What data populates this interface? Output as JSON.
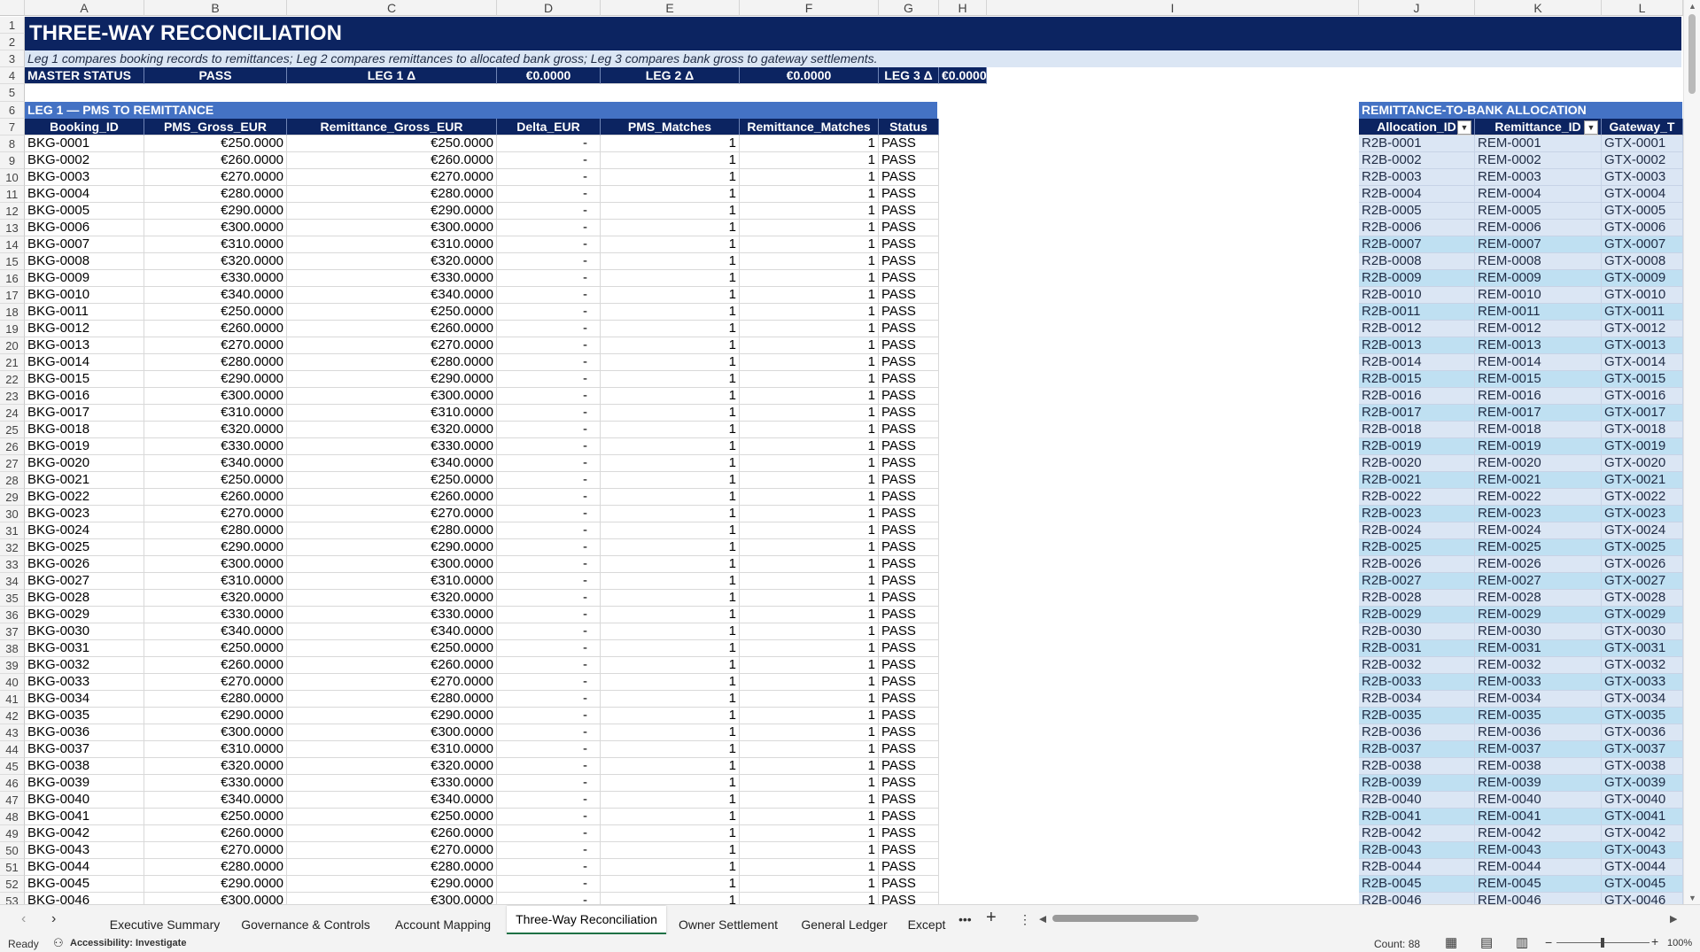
{
  "columns": [
    "A",
    "B",
    "C",
    "D",
    "E",
    "F",
    "G",
    "H",
    "I",
    "J",
    "K",
    "L"
  ],
  "title": "THREE-WAY RECONCILIATION",
  "subtitle": "Leg 1 compares booking records to remittances; Leg 2 compares remittances to allocated bank gross; Leg 3 compares bank gross to gateway settlements.",
  "status_row": {
    "master_label": "MASTER STATUS",
    "master_value": "PASS",
    "leg1_label": "LEG 1 Δ",
    "leg1_value": "€0.0000",
    "leg2_label": "LEG 2 Δ",
    "leg2_value": "€0.0000",
    "leg3_label": "LEG 3 Δ",
    "leg3_value": "€0.0000"
  },
  "leg1": {
    "section_title": "LEG 1 — PMS TO REMITTANCE",
    "headers": [
      "Booking_ID",
      "PMS_Gross_EUR",
      "Remittance_Gross_EUR",
      "Delta_EUR",
      "PMS_Matches",
      "Remittance_Matches",
      "Status"
    ],
    "rows": [
      [
        "BKG-0001",
        "€250.0000",
        "€250.0000",
        "-",
        "1",
        "1",
        "PASS"
      ],
      [
        "BKG-0002",
        "€260.0000",
        "€260.0000",
        "-",
        "1",
        "1",
        "PASS"
      ],
      [
        "BKG-0003",
        "€270.0000",
        "€270.0000",
        "-",
        "1",
        "1",
        "PASS"
      ],
      [
        "BKG-0004",
        "€280.0000",
        "€280.0000",
        "-",
        "1",
        "1",
        "PASS"
      ],
      [
        "BKG-0005",
        "€290.0000",
        "€290.0000",
        "-",
        "1",
        "1",
        "PASS"
      ],
      [
        "BKG-0006",
        "€300.0000",
        "€300.0000",
        "-",
        "1",
        "1",
        "PASS"
      ],
      [
        "BKG-0007",
        "€310.0000",
        "€310.0000",
        "-",
        "1",
        "1",
        "PASS"
      ],
      [
        "BKG-0008",
        "€320.0000",
        "€320.0000",
        "-",
        "1",
        "1",
        "PASS"
      ],
      [
        "BKG-0009",
        "€330.0000",
        "€330.0000",
        "-",
        "1",
        "1",
        "PASS"
      ],
      [
        "BKG-0010",
        "€340.0000",
        "€340.0000",
        "-",
        "1",
        "1",
        "PASS"
      ],
      [
        "BKG-0011",
        "€250.0000",
        "€250.0000",
        "-",
        "1",
        "1",
        "PASS"
      ],
      [
        "BKG-0012",
        "€260.0000",
        "€260.0000",
        "-",
        "1",
        "1",
        "PASS"
      ],
      [
        "BKG-0013",
        "€270.0000",
        "€270.0000",
        "-",
        "1",
        "1",
        "PASS"
      ],
      [
        "BKG-0014",
        "€280.0000",
        "€280.0000",
        "-",
        "1",
        "1",
        "PASS"
      ],
      [
        "BKG-0015",
        "€290.0000",
        "€290.0000",
        "-",
        "1",
        "1",
        "PASS"
      ],
      [
        "BKG-0016",
        "€300.0000",
        "€300.0000",
        "-",
        "1",
        "1",
        "PASS"
      ],
      [
        "BKG-0017",
        "€310.0000",
        "€310.0000",
        "-",
        "1",
        "1",
        "PASS"
      ],
      [
        "BKG-0018",
        "€320.0000",
        "€320.0000",
        "-",
        "1",
        "1",
        "PASS"
      ],
      [
        "BKG-0019",
        "€330.0000",
        "€330.0000",
        "-",
        "1",
        "1",
        "PASS"
      ],
      [
        "BKG-0020",
        "€340.0000",
        "€340.0000",
        "-",
        "1",
        "1",
        "PASS"
      ],
      [
        "BKG-0021",
        "€250.0000",
        "€250.0000",
        "-",
        "1",
        "1",
        "PASS"
      ],
      [
        "BKG-0022",
        "€260.0000",
        "€260.0000",
        "-",
        "1",
        "1",
        "PASS"
      ],
      [
        "BKG-0023",
        "€270.0000",
        "€270.0000",
        "-",
        "1",
        "1",
        "PASS"
      ],
      [
        "BKG-0024",
        "€280.0000",
        "€280.0000",
        "-",
        "1",
        "1",
        "PASS"
      ],
      [
        "BKG-0025",
        "€290.0000",
        "€290.0000",
        "-",
        "1",
        "1",
        "PASS"
      ],
      [
        "BKG-0026",
        "€300.0000",
        "€300.0000",
        "-",
        "1",
        "1",
        "PASS"
      ],
      [
        "BKG-0027",
        "€310.0000",
        "€310.0000",
        "-",
        "1",
        "1",
        "PASS"
      ],
      [
        "BKG-0028",
        "€320.0000",
        "€320.0000",
        "-",
        "1",
        "1",
        "PASS"
      ],
      [
        "BKG-0029",
        "€330.0000",
        "€330.0000",
        "-",
        "1",
        "1",
        "PASS"
      ],
      [
        "BKG-0030",
        "€340.0000",
        "€340.0000",
        "-",
        "1",
        "1",
        "PASS"
      ],
      [
        "BKG-0031",
        "€250.0000",
        "€250.0000",
        "-",
        "1",
        "1",
        "PASS"
      ],
      [
        "BKG-0032",
        "€260.0000",
        "€260.0000",
        "-",
        "1",
        "1",
        "PASS"
      ],
      [
        "BKG-0033",
        "€270.0000",
        "€270.0000",
        "-",
        "1",
        "1",
        "PASS"
      ],
      [
        "BKG-0034",
        "€280.0000",
        "€280.0000",
        "-",
        "1",
        "1",
        "PASS"
      ],
      [
        "BKG-0035",
        "€290.0000",
        "€290.0000",
        "-",
        "1",
        "1",
        "PASS"
      ],
      [
        "BKG-0036",
        "€300.0000",
        "€300.0000",
        "-",
        "1",
        "1",
        "PASS"
      ],
      [
        "BKG-0037",
        "€310.0000",
        "€310.0000",
        "-",
        "1",
        "1",
        "PASS"
      ],
      [
        "BKG-0038",
        "€320.0000",
        "€320.0000",
        "-",
        "1",
        "1",
        "PASS"
      ],
      [
        "BKG-0039",
        "€330.0000",
        "€330.0000",
        "-",
        "1",
        "1",
        "PASS"
      ],
      [
        "BKG-0040",
        "€340.0000",
        "€340.0000",
        "-",
        "1",
        "1",
        "PASS"
      ],
      [
        "BKG-0041",
        "€250.0000",
        "€250.0000",
        "-",
        "1",
        "1",
        "PASS"
      ],
      [
        "BKG-0042",
        "€260.0000",
        "€260.0000",
        "-",
        "1",
        "1",
        "PASS"
      ],
      [
        "BKG-0043",
        "€270.0000",
        "€270.0000",
        "-",
        "1",
        "1",
        "PASS"
      ],
      [
        "BKG-0044",
        "€280.0000",
        "€280.0000",
        "-",
        "1",
        "1",
        "PASS"
      ],
      [
        "BKG-0045",
        "€290.0000",
        "€290.0000",
        "-",
        "1",
        "1",
        "PASS"
      ],
      [
        "BKG-0046",
        "€300.0000",
        "€300.0000",
        "-",
        "1",
        "1",
        "PASS"
      ]
    ]
  },
  "allocation": {
    "section_title": "REMITTANCE-TO-BANK ALLOCATION",
    "headers": [
      "Allocation_ID",
      "Remittance_ID",
      "Gateway_T"
    ],
    "rows": [
      [
        "R2B-0001",
        "REM-0001",
        "GTX-0001"
      ],
      [
        "R2B-0002",
        "REM-0002",
        "GTX-0002"
      ],
      [
        "R2B-0003",
        "REM-0003",
        "GTX-0003"
      ],
      [
        "R2B-0004",
        "REM-0004",
        "GTX-0004"
      ],
      [
        "R2B-0005",
        "REM-0005",
        "GTX-0005"
      ],
      [
        "R2B-0006",
        "REM-0006",
        "GTX-0006"
      ],
      [
        "R2B-0007",
        "REM-0007",
        "GTX-0007"
      ],
      [
        "R2B-0008",
        "REM-0008",
        "GTX-0008"
      ],
      [
        "R2B-0009",
        "REM-0009",
        "GTX-0009"
      ],
      [
        "R2B-0010",
        "REM-0010",
        "GTX-0010"
      ],
      [
        "R2B-0011",
        "REM-0011",
        "GTX-0011"
      ],
      [
        "R2B-0012",
        "REM-0012",
        "GTX-0012"
      ],
      [
        "R2B-0013",
        "REM-0013",
        "GTX-0013"
      ],
      [
        "R2B-0014",
        "REM-0014",
        "GTX-0014"
      ],
      [
        "R2B-0015",
        "REM-0015",
        "GTX-0015"
      ],
      [
        "R2B-0016",
        "REM-0016",
        "GTX-0016"
      ],
      [
        "R2B-0017",
        "REM-0017",
        "GTX-0017"
      ],
      [
        "R2B-0018",
        "REM-0018",
        "GTX-0018"
      ],
      [
        "R2B-0019",
        "REM-0019",
        "GTX-0019"
      ],
      [
        "R2B-0020",
        "REM-0020",
        "GTX-0020"
      ],
      [
        "R2B-0021",
        "REM-0021",
        "GTX-0021"
      ],
      [
        "R2B-0022",
        "REM-0022",
        "GTX-0022"
      ],
      [
        "R2B-0023",
        "REM-0023",
        "GTX-0023"
      ],
      [
        "R2B-0024",
        "REM-0024",
        "GTX-0024"
      ],
      [
        "R2B-0025",
        "REM-0025",
        "GTX-0025"
      ],
      [
        "R2B-0026",
        "REM-0026",
        "GTX-0026"
      ],
      [
        "R2B-0027",
        "REM-0027",
        "GTX-0027"
      ],
      [
        "R2B-0028",
        "REM-0028",
        "GTX-0028"
      ],
      [
        "R2B-0029",
        "REM-0029",
        "GTX-0029"
      ],
      [
        "R2B-0030",
        "REM-0030",
        "GTX-0030"
      ],
      [
        "R2B-0031",
        "REM-0031",
        "GTX-0031"
      ],
      [
        "R2B-0032",
        "REM-0032",
        "GTX-0032"
      ],
      [
        "R2B-0033",
        "REM-0033",
        "GTX-0033"
      ],
      [
        "R2B-0034",
        "REM-0034",
        "GTX-0034"
      ],
      [
        "R2B-0035",
        "REM-0035",
        "GTX-0035"
      ],
      [
        "R2B-0036",
        "REM-0036",
        "GTX-0036"
      ],
      [
        "R2B-0037",
        "REM-0037",
        "GTX-0037"
      ],
      [
        "R2B-0038",
        "REM-0038",
        "GTX-0038"
      ],
      [
        "R2B-0039",
        "REM-0039",
        "GTX-0039"
      ],
      [
        "R2B-0040",
        "REM-0040",
        "GTX-0040"
      ],
      [
        "R2B-0041",
        "REM-0041",
        "GTX-0041"
      ],
      [
        "R2B-0042",
        "REM-0042",
        "GTX-0042"
      ],
      [
        "R2B-0043",
        "REM-0043",
        "GTX-0043"
      ],
      [
        "R2B-0044",
        "REM-0044",
        "GTX-0044"
      ],
      [
        "R2B-0045",
        "REM-0045",
        "GTX-0045"
      ],
      [
        "R2B-0046",
        "REM-0046",
        "GTX-0046"
      ]
    ]
  },
  "sheet_tabs": [
    "Executive Summary",
    "Governance & Controls",
    "Account Mapping",
    "Three-Way Reconciliation",
    "Owner Settlement",
    "General Ledger",
    "Except"
  ],
  "active_tab": "Three-Way Reconciliation",
  "status_bar": {
    "ready": "Ready",
    "accessibility": "Accessibility: Investigate",
    "count": "Count: 88",
    "zoom": "100%"
  },
  "colors": {
    "navy": "#0c2461",
    "section_blue": "#4472c4",
    "light_blue": "#dbe6f4",
    "selection_blue": "#bfe0f2",
    "active_tab_green": "#1e7145"
  },
  "icons": [
    "tab-prev-icon",
    "tab-next-icon",
    "more-tabs-icon",
    "add-sheet-icon",
    "sheet-options-icon",
    "scroll-left-icon",
    "scroll-right-icon",
    "accessibility-icon",
    "normal-view-icon",
    "page-layout-icon",
    "page-break-icon",
    "filter-dropdown-icon"
  ]
}
